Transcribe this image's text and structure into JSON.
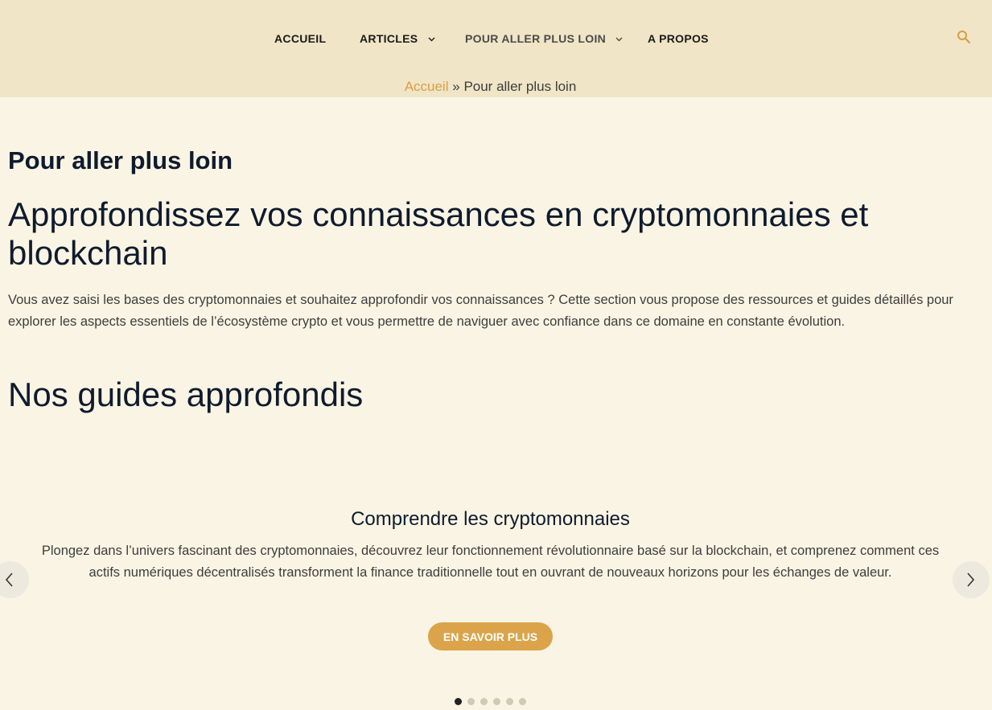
{
  "nav": {
    "items": [
      {
        "label": "ACCUEIL",
        "has_dropdown": false
      },
      {
        "label": "ARTICLES",
        "has_dropdown": true
      },
      {
        "label": "POUR ALLER PLUS LOIN",
        "has_dropdown": true,
        "active": true
      },
      {
        "label": "A PROPOS",
        "has_dropdown": false
      }
    ],
    "search_icon": "search-icon"
  },
  "breadcrumb": {
    "home": "Accueil",
    "separator": "»",
    "current": "Pour aller plus loin"
  },
  "page": {
    "title": "Pour aller plus loin",
    "heading": "Approfondissez vos connaissances en cryptomonnaies et blockchain",
    "intro": "Vous avez saisi les bases des cryptomonnaies et souhaitez approfondir vos connaissances ? Cette section vous propose des ressources et guides détaillés pour explorer les aspects essentiels de l’écosystème crypto et vous permettre de naviguer avec confiance dans ce domaine en constante évolution.",
    "section_heading": "Nos guides approfondis"
  },
  "slider": {
    "slide_title": "Comprendre les cryptomonnaies",
    "slide_text": "Plongez dans l’univers fascinant des cryptomonnaies, découvrez leur fonctionnement révolutionnaire basé sur la blockchain, et comprenez comment ces actifs numériques décentralisés transforment la finance traditionnelle tout en ouvrant de nouveaux horizons pour les échanges de valeur.",
    "button_label": "EN SAVOIR PLUS",
    "prev_icon": "chevron-left-icon",
    "next_icon": "chevron-right-icon",
    "dot_count": 6,
    "active_dot": 1
  },
  "colors": {
    "header_bg": "#f0e5c6",
    "page_bg": "#faf4e4",
    "accent": "#dba44a",
    "link": "#d99e45",
    "heading": "#0f1b2d",
    "body_text": "#3d3d3d"
  }
}
